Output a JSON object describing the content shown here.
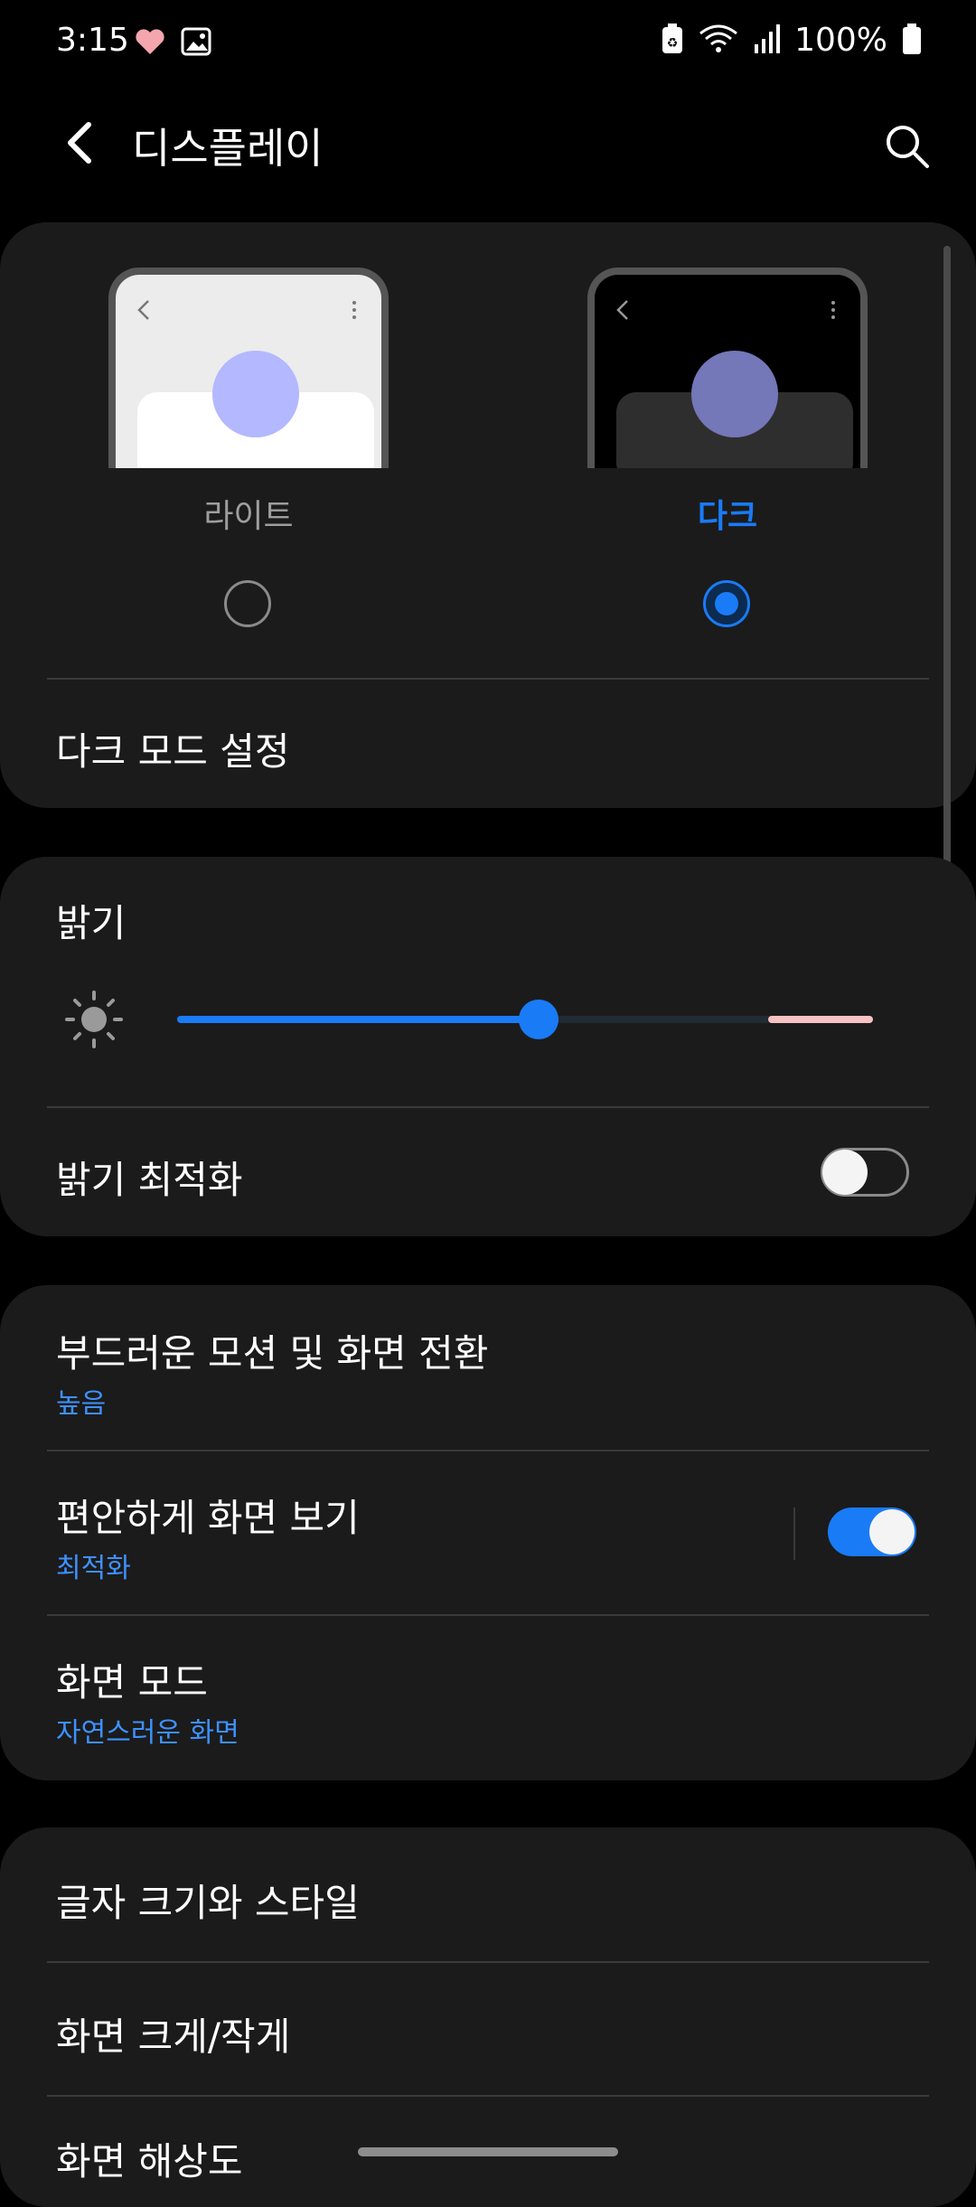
{
  "status_bar": {
    "time": "3:15",
    "battery_percent": "100%",
    "left_icons": [
      "heart-icon",
      "gallery-icon"
    ],
    "right_icons": [
      "battery-saver-icon",
      "wifi-icon",
      "signal-icon",
      "battery-icon"
    ]
  },
  "app_bar": {
    "title": "디스플레이",
    "back_icon": "back-arrow-icon",
    "search_icon": "search-icon"
  },
  "theme": {
    "light_label": "라이트",
    "dark_label": "다크",
    "selected": "dark",
    "dark_mode_settings": "다크 모드 설정"
  },
  "brightness": {
    "title": "밝기",
    "level_percent": 52,
    "adaptive_label": "밝기 최적화",
    "adaptive_on": false
  },
  "motion": {
    "title": "부드러운 모션 및 화면 전환",
    "value": "높음"
  },
  "eye_comfort": {
    "title": "편안하게 화면 보기",
    "value": "최적화",
    "enabled": true
  },
  "screen_mode": {
    "title": "화면 모드",
    "value": "자연스러운 화면"
  },
  "font": {
    "title": "글자 크기와 스타일"
  },
  "zoom": {
    "title": "화면 크게/작게"
  },
  "resolution": {
    "title": "화면 해상도"
  },
  "colors": {
    "accent": "#1a7bf6",
    "subtext": "#3e91ff",
    "card_bg": "#1b1b1b"
  }
}
